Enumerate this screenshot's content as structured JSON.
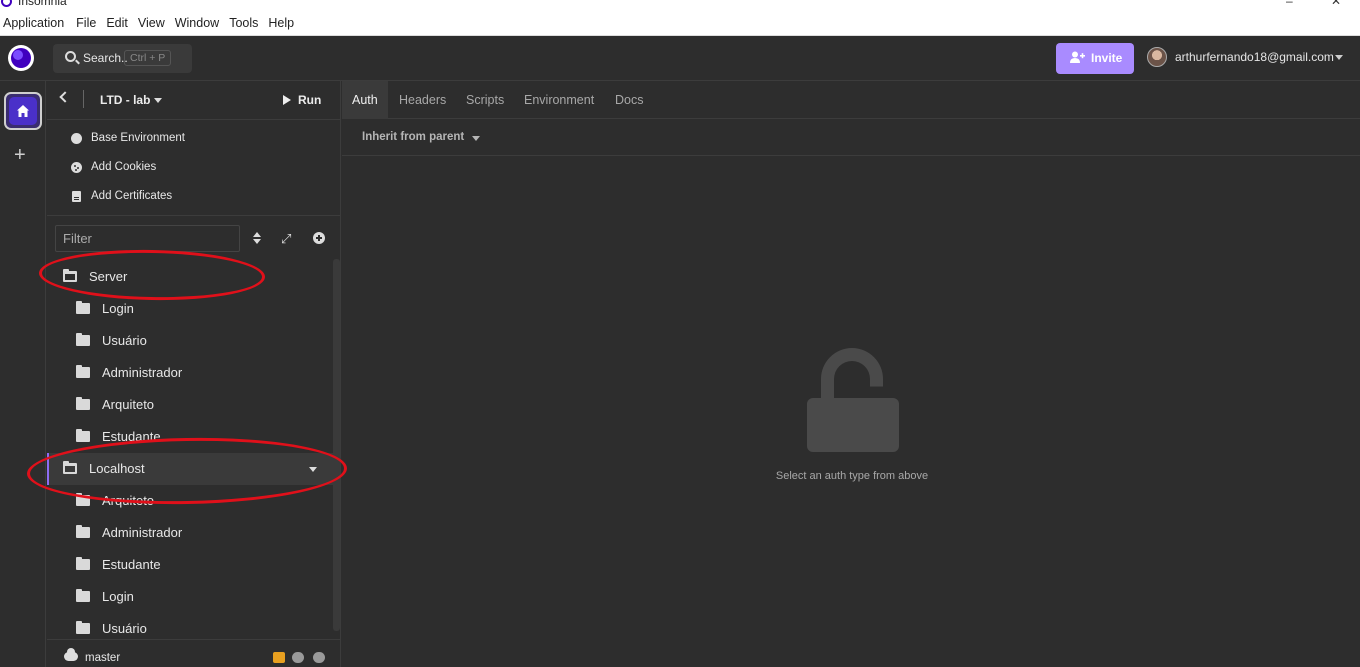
{
  "window": {
    "title": "Insomnia",
    "minimize_glyph": "–",
    "close_glyph": "✕"
  },
  "menubar": {
    "items": [
      "Application",
      "File",
      "Edit",
      "View",
      "Window",
      "Tools",
      "Help"
    ]
  },
  "header": {
    "search_label": "Search..",
    "search_shortcut": "Ctrl + P",
    "invite_label": "Invite",
    "user_email": "arthurfernando18@gmail.com"
  },
  "sidebar": {
    "project_name": "LTD - lab",
    "run_label": "Run",
    "env_items": [
      {
        "label": "Base Environment",
        "icon": "globe-icon"
      },
      {
        "label": "Add Cookies",
        "icon": "cookie-icon"
      },
      {
        "label": "Add Certificates",
        "icon": "certificate-icon"
      }
    ],
    "filter_placeholder": "Filter",
    "tree": [
      {
        "label": "Server",
        "level": 0,
        "open": true
      },
      {
        "label": "Login",
        "level": 1
      },
      {
        "label": "Usuário",
        "level": 1
      },
      {
        "label": "Administrador",
        "level": 1
      },
      {
        "label": "Arquiteto",
        "level": 1
      },
      {
        "label": "Estudante",
        "level": 1
      },
      {
        "label": "Localhost",
        "level": 0,
        "open": true,
        "active": true
      },
      {
        "label": "Arquiteto",
        "level": 1
      },
      {
        "label": "Administrador",
        "level": 1
      },
      {
        "label": "Estudante",
        "level": 1
      },
      {
        "label": "Login",
        "level": 1
      },
      {
        "label": "Usuário",
        "level": 1
      }
    ],
    "branch": "master"
  },
  "main": {
    "tabs": [
      "Auth",
      "Headers",
      "Scripts",
      "Environment",
      "Docs"
    ],
    "active_tab": "Auth",
    "inherit_label": "Inherit from parent",
    "empty_hint": "Select an auth type from above"
  },
  "colors": {
    "accent": "#a98bff",
    "brand": "#4000bf",
    "annotation": "#e0101a",
    "background": "#2d2d2d"
  }
}
